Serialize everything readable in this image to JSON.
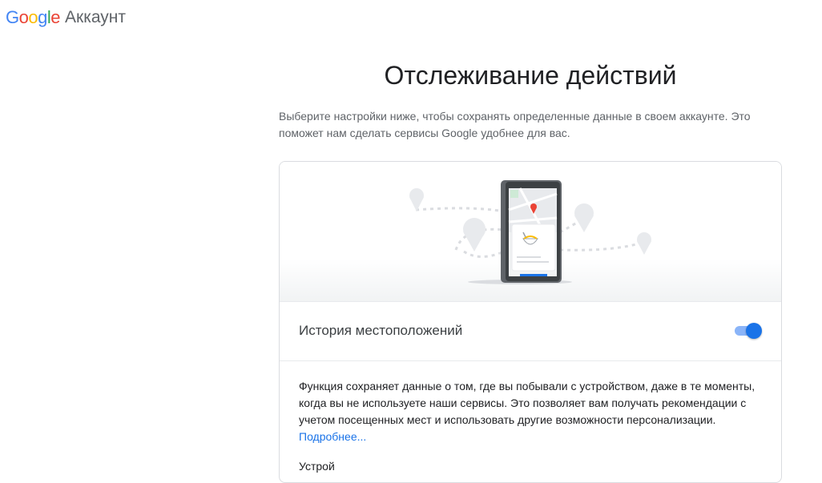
{
  "header": {
    "logo_letters": [
      {
        "ch": "G",
        "color": "#4285F4"
      },
      {
        "ch": "o",
        "color": "#EA4335"
      },
      {
        "ch": "o",
        "color": "#FBBC05"
      },
      {
        "ch": "g",
        "color": "#4285F4"
      },
      {
        "ch": "l",
        "color": "#34A853"
      },
      {
        "ch": "e",
        "color": "#EA4335"
      }
    ],
    "product_name": "Аккаунт"
  },
  "page": {
    "title": "Отслеживание действий",
    "intro": "Выберите настройки ниже, чтобы сохранять определенные данные в своем аккаунте. Это поможет нам сделать сервисы Google удобнее для вас."
  },
  "setting": {
    "label": "История местоположений",
    "toggle_on": true,
    "description": "Функция сохраняет данные о том, где вы побывали с устройством, даже в те моменты, когда вы не используете наши сервисы. Это позволяет вам получать рекомендации с учетом посещенных мест и использовать другие возможности персонализации.",
    "learn_more": "Подробнее...",
    "next_text": "Устрой"
  },
  "colors": {
    "accent": "#1a73e8",
    "accent_light": "#8ab4f8"
  }
}
